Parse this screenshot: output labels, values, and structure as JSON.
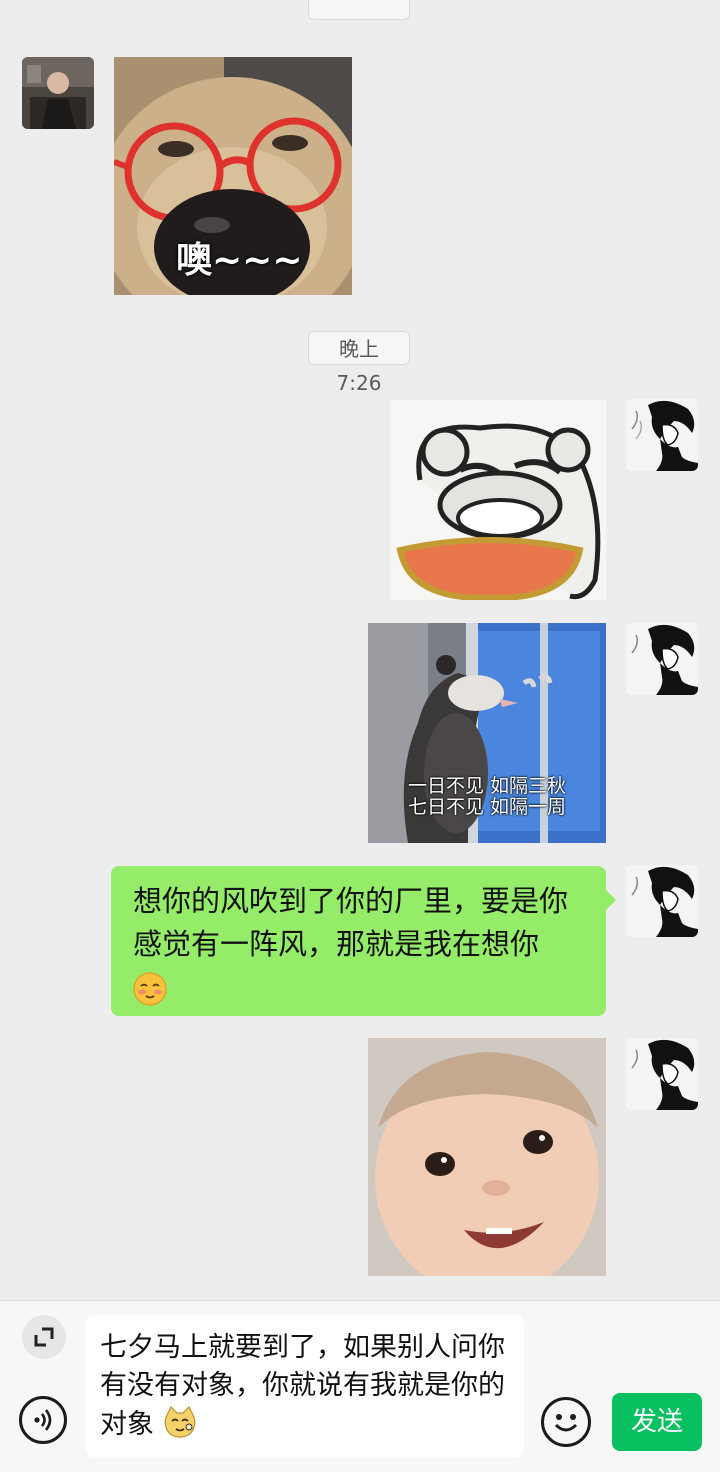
{
  "chat": {
    "time_divider": "晚上7:26",
    "stickers": {
      "dog_caption": "噢~~~",
      "possum_caption_line1": "一日不见 如隔三秋",
      "possum_caption_line2": "七日不见 如隔一周"
    },
    "green_bubble_text": "想你的风吹到了你的厂里，要是你感觉有一阵风，那就是我在想你"
  },
  "input": {
    "draft_text": "七夕马上就要到了，如果别人问你有没有对象，你就说有我就是你的对象",
    "send_label": "发送"
  },
  "icons": {
    "expand": "expand-icon",
    "voice": "voice-icon",
    "emoji": "emoji-icon"
  },
  "colors": {
    "background": "#ededed",
    "bubble_green": "#95ec69",
    "send_button": "#07c160"
  }
}
